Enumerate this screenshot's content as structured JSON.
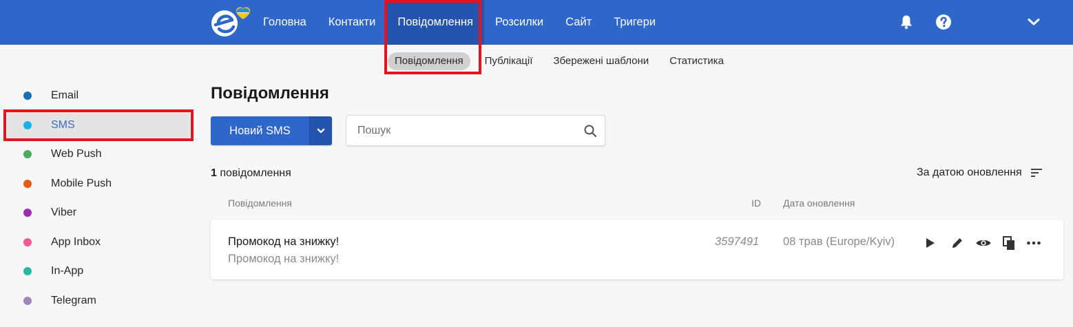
{
  "topnav": {
    "items": [
      {
        "label": "Головна",
        "active": false
      },
      {
        "label": "Контакти",
        "active": false
      },
      {
        "label": "Повідомлення",
        "active": true
      },
      {
        "label": "Розсилки",
        "active": false
      },
      {
        "label": "Сайт",
        "active": false
      },
      {
        "label": "Тригери",
        "active": false
      }
    ],
    "icons": [
      "bell-icon",
      "help-icon",
      "chevron-down-icon"
    ]
  },
  "subnav": {
    "items": [
      {
        "label": "Повідомлення",
        "active": true
      },
      {
        "label": "Публікації",
        "active": false
      },
      {
        "label": "Збережені шаблони",
        "active": false
      },
      {
        "label": "Статистика",
        "active": false
      }
    ]
  },
  "sidebar": {
    "items": [
      {
        "label": "Email",
        "color": "#1a6fb5",
        "active": false
      },
      {
        "label": "SMS",
        "color": "#1ab1e8",
        "active": true
      },
      {
        "label": "Web Push",
        "color": "#4caa5e",
        "active": false
      },
      {
        "label": "Mobile Push",
        "color": "#e85a1a",
        "active": false
      },
      {
        "label": "Viber",
        "color": "#9b2fae",
        "active": false
      },
      {
        "label": "App Inbox",
        "color": "#ef5b93",
        "active": false
      },
      {
        "label": "In-App",
        "color": "#26b9a1",
        "active": false
      },
      {
        "label": "Telegram",
        "color": "#9f83bf",
        "active": false
      }
    ]
  },
  "main": {
    "title": "Повідомлення",
    "new_button": "Новий SMS",
    "search_placeholder": "Пошук",
    "count_number": "1",
    "count_label": "повідомлення",
    "sort_label": "За датою оновлення",
    "columns": {
      "message": "Повідомлення",
      "id": "ID",
      "date": "Дата оновлення"
    },
    "rows": [
      {
        "title": "Промокод на знижку!",
        "subtitle": "Промокод на знижку!",
        "id": "3597491",
        "date": "08 трав (Europe/Kyiv)"
      }
    ]
  },
  "colors": {
    "header_bg": "#2e66c9",
    "header_active": "#2454ad",
    "highlight_red": "#e8121f",
    "accent_text": "#3a6bc6"
  }
}
